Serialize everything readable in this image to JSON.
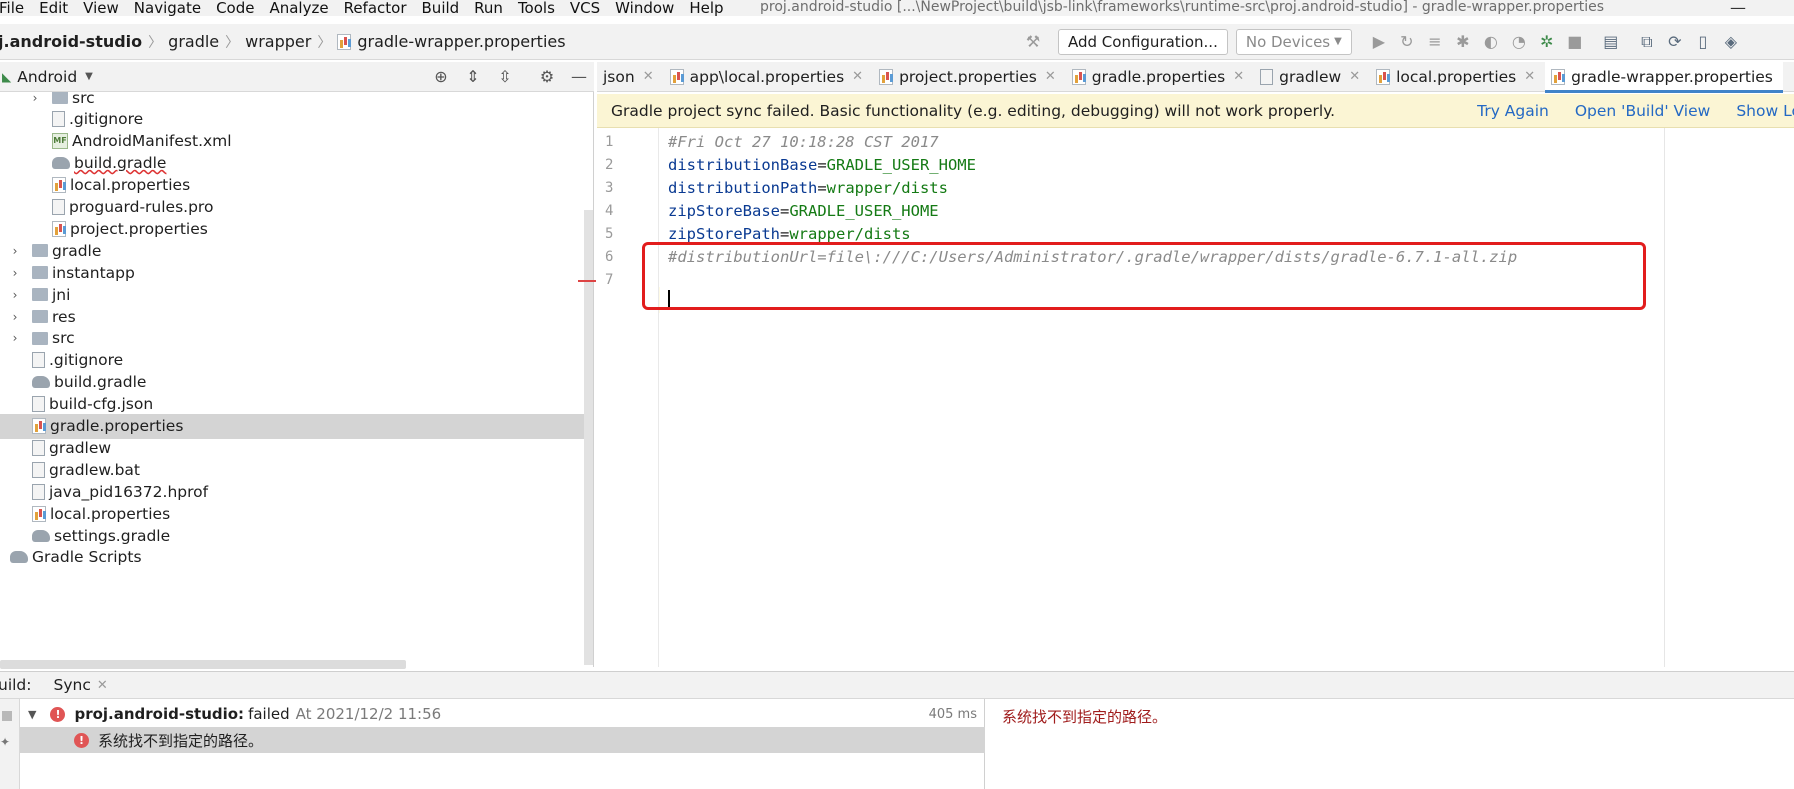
{
  "menu": {
    "items": [
      {
        "label": "File"
      },
      {
        "label": "Edit"
      },
      {
        "label": "View"
      },
      {
        "label": "Navigate"
      },
      {
        "label": "Code"
      },
      {
        "label": "Analyze"
      },
      {
        "label": "Refactor"
      },
      {
        "label": "Build"
      },
      {
        "label": "Run"
      },
      {
        "label": "Tools"
      },
      {
        "label": "VCS"
      },
      {
        "label": "Window"
      },
      {
        "label": "Help"
      }
    ],
    "window_title": "proj.android-studio [...\\NewProject\\build\\jsb-link\\frameworks\\runtime-src\\proj.android-studio] - gradle-wrapper.properties",
    "minimize_glyph": "—"
  },
  "navbar": {
    "breadcrumbs": [
      "j.android-studio",
      "gradle",
      "wrapper",
      "gradle-wrapper.properties"
    ],
    "add_configuration": "Add Configuration...",
    "devices": "No Devices"
  },
  "project": {
    "view": "Android",
    "tree": [
      {
        "label": "src",
        "type": "folder",
        "depth": 2,
        "arrow": "›"
      },
      {
        "label": ".gitignore",
        "type": "doc",
        "depth": 2
      },
      {
        "label": "AndroidManifest.xml",
        "type": "mf",
        "depth": 2
      },
      {
        "label": "build.gradle",
        "type": "gradle",
        "depth": 2,
        "squiggle": true
      },
      {
        "label": "local.properties",
        "type": "props",
        "depth": 2
      },
      {
        "label": "proguard-rules.pro",
        "type": "doc",
        "depth": 2
      },
      {
        "label": "project.properties",
        "type": "props",
        "depth": 2
      },
      {
        "label": "gradle",
        "type": "folder",
        "depth": 1,
        "arrow": "›"
      },
      {
        "label": "instantapp",
        "type": "folder",
        "depth": 1,
        "arrow": "›"
      },
      {
        "label": "jni",
        "type": "folder",
        "depth": 1,
        "arrow": "›"
      },
      {
        "label": "res",
        "type": "folder",
        "depth": 1,
        "arrow": "›"
      },
      {
        "label": "src",
        "type": "folder",
        "depth": 1,
        "arrow": "›"
      },
      {
        "label": ".gitignore",
        "type": "doc",
        "depth": 1
      },
      {
        "label": "build.gradle",
        "type": "gradle",
        "depth": 1
      },
      {
        "label": "build-cfg.json",
        "type": "doc",
        "depth": 1
      },
      {
        "label": "gradle.properties",
        "type": "props",
        "depth": 1,
        "selected": true
      },
      {
        "label": "gradlew",
        "type": "doc",
        "depth": 1
      },
      {
        "label": "gradlew.bat",
        "type": "doc",
        "depth": 1
      },
      {
        "label": "java_pid16372.hprof",
        "type": "doc",
        "depth": 1
      },
      {
        "label": "local.properties",
        "type": "props",
        "depth": 1
      },
      {
        "label": "settings.gradle",
        "type": "gradle",
        "depth": 1
      },
      {
        "label": "Gradle Scripts",
        "type": "gradle",
        "depth": 0
      }
    ]
  },
  "tabs": [
    {
      "label": "json",
      "icon": "none"
    },
    {
      "label": "app\\local.properties",
      "icon": "props"
    },
    {
      "label": "project.properties",
      "icon": "props"
    },
    {
      "label": "gradle.properties",
      "icon": "props"
    },
    {
      "label": "gradlew",
      "icon": "doc"
    },
    {
      "label": "local.properties",
      "icon": "props"
    },
    {
      "label": "gradle-wrapper.properties",
      "icon": "props",
      "active": true
    }
  ],
  "banner": {
    "message": "Gradle project sync failed. Basic functionality (e.g. editing, debugging) will not work properly.",
    "try_again": "Try Again",
    "open_build": "Open 'Build' View",
    "show_log": "Show Log in Exp"
  },
  "editor": {
    "lines": [
      {
        "n": "1",
        "comment": "#Fri Oct 27 10:18:28 CST 2017"
      },
      {
        "n": "2",
        "key": "distributionBase",
        "value": "GRADLE_USER_HOME"
      },
      {
        "n": "3",
        "key": "distributionPath",
        "value": "wrapper/dists"
      },
      {
        "n": "4",
        "key": "zipStoreBase",
        "value": "GRADLE_USER_HOME"
      },
      {
        "n": "5",
        "key": "zipStorePath",
        "value": "wrapper/dists"
      },
      {
        "n": "6",
        "comment": "#distributionUrl=file\\:///C:/Users/Administrator/.gradle/wrapper/dists/gradle-6.7.1-all.zip"
      },
      {
        "n": "7",
        "comment": ""
      }
    ]
  },
  "build": {
    "label": "uild:",
    "tab": "Sync",
    "project": "proj.android-studio:",
    "status": "failed",
    "time": "At 2021/12/2 11:56",
    "duration": "405 ms",
    "error_item": "系统找不到指定的路径。",
    "message": "系统找不到指定的路径。"
  }
}
